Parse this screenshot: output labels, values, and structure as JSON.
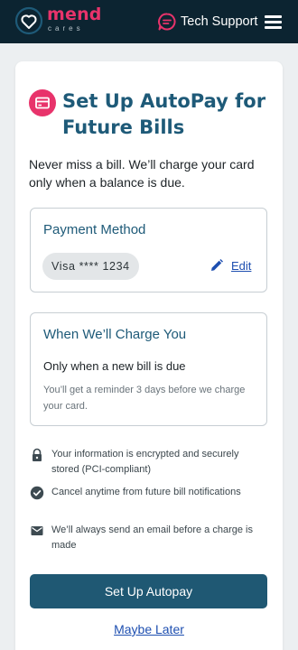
{
  "header": {
    "logo_name": "mend",
    "logo_sub": "cares",
    "support_label": "Tech Support",
    "brand_color": "#e8336b",
    "bg_color": "#0c2431"
  },
  "page": {
    "title": "Set Up AutoPay for Future Bills",
    "intro": "Never miss a bill. We’ll charge your card only when a balance is due."
  },
  "payment_method": {
    "title": "Payment Method",
    "card": "Visa **** 1234",
    "edit_label": "Edit"
  },
  "charge": {
    "title": "When We’ll Charge You",
    "main": "Only when a new bill is due",
    "sub": "You’ll get a reminder 3 days before we charge your card."
  },
  "notes": [
    {
      "icon": "lock-icon",
      "text": "Your information is encrypted and securely stored (PCI-compliant)"
    },
    {
      "icon": "check-circle-icon",
      "text": "Cancel anytime from future bill notifications"
    },
    {
      "icon": "mail-icon",
      "text": "We’ll always send an email before a charge is made"
    }
  ],
  "actions": {
    "primary_label": "Set Up Autopay",
    "secondary_label": "Maybe Later",
    "primary_color": "#1f5873",
    "link_color": "#1e4fb0"
  }
}
